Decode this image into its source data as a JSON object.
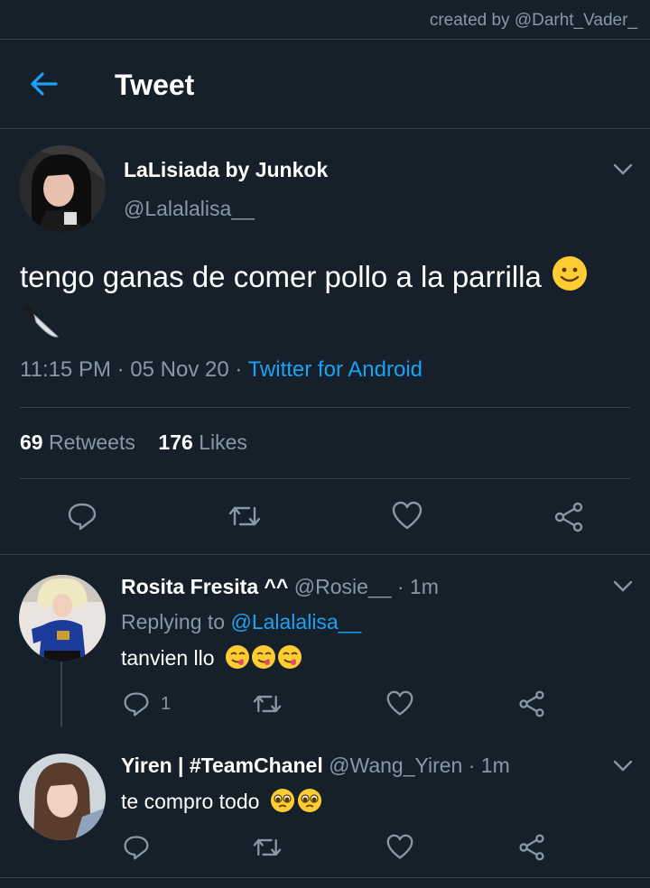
{
  "watermark": "created by @Darht_Vader_",
  "header": {
    "title": "Tweet"
  },
  "tweet": {
    "name": "LaLisiada by Junkok",
    "handle": "@Lalalalisa__",
    "text": "tengo ganas de comer pollo a la parrilla",
    "time": "11:15 PM · 05 Nov 20 · ",
    "source": "Twitter for Android",
    "retweets": "69",
    "retweets_label": "Retweets",
    "likes": "176",
    "likes_label": "Likes"
  },
  "replies": [
    {
      "name": "Rosita Fresita ^^",
      "handle": "@Rosie__",
      "time": "· 1m",
      "replying_prefix": "Replying to ",
      "replying_to": "@Lalalalisa__",
      "text": "tanvien llo",
      "reply_count": "1"
    },
    {
      "name": "Yiren | #TeamChanel",
      "handle": "@Wang_Yiren",
      "time": "· 1m",
      "text": "te compro todo"
    }
  ],
  "colors": {
    "background": "#15202b",
    "accent": "#1da1f2",
    "muted": "#8899a6",
    "divider": "#38444d"
  }
}
